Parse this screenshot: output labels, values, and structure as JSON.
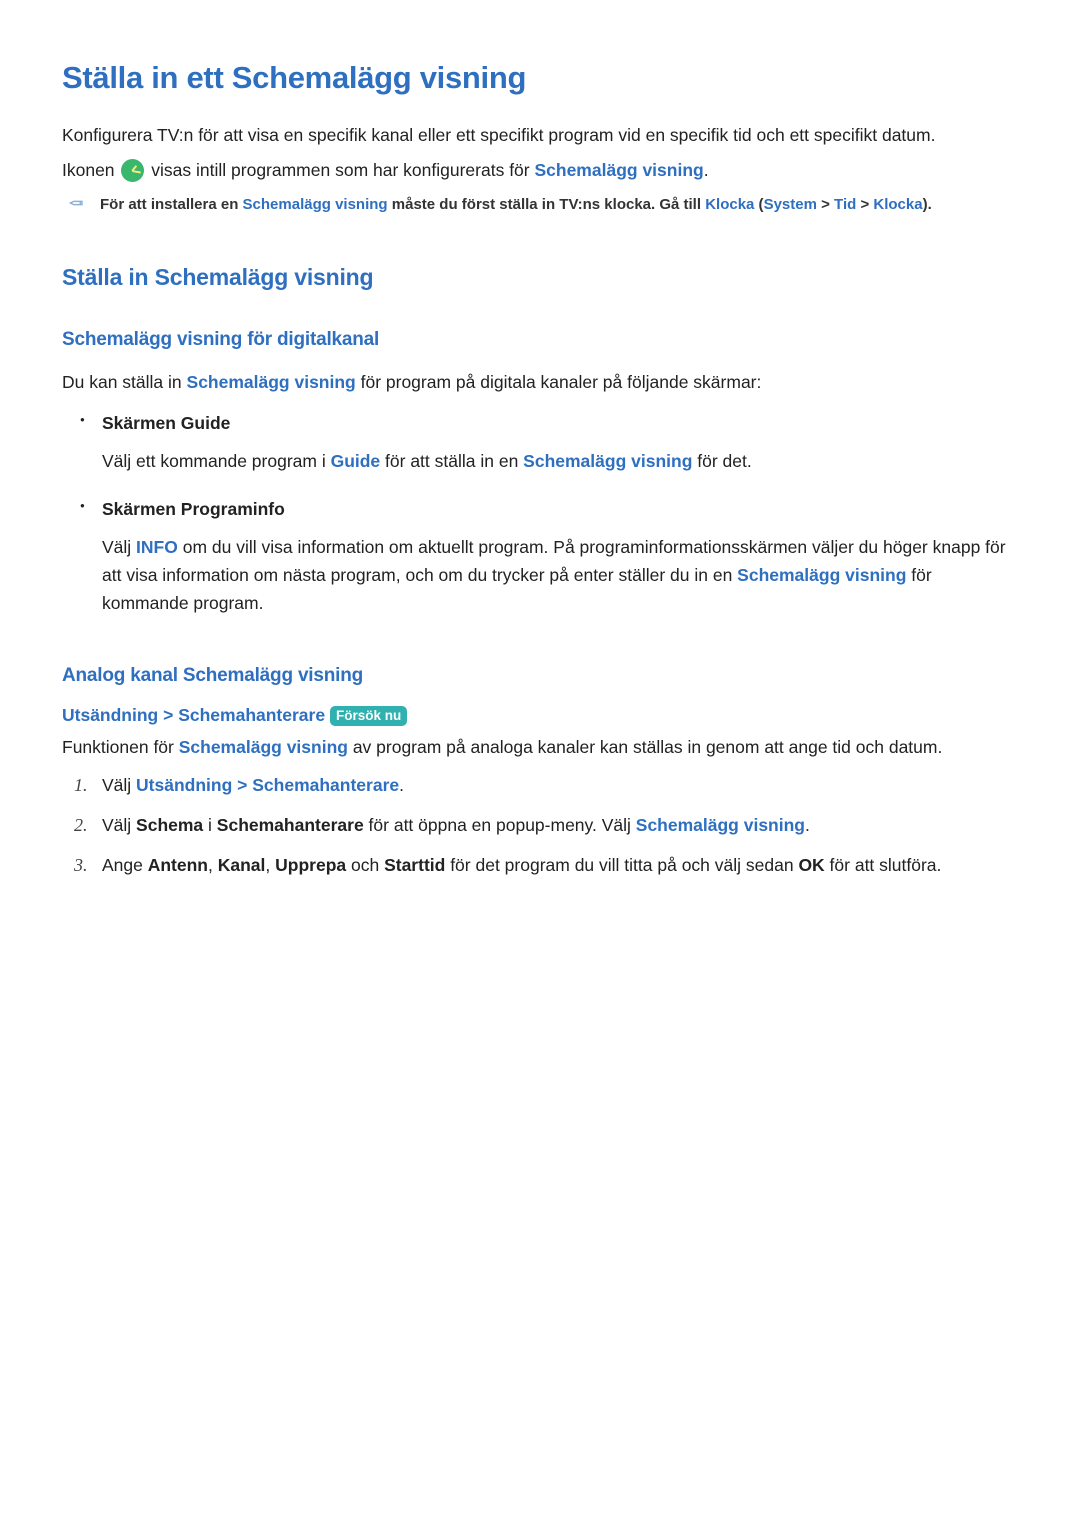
{
  "title": "Ställa in ett Schemalägg visning",
  "intro": {
    "line1": "Konfigurera TV:n för att visa en specifik kanal eller ett specifikt program vid en specifik tid och ett specifikt datum.",
    "line2_a": "Ikonen ",
    "line2_b": " visas intill programmen som har konfigurerats för ",
    "line2_link": "Schemalägg visning",
    "line2_c": "."
  },
  "note": {
    "pre": "För att installera en ",
    "link1": "Schemalägg visning",
    "mid": " måste du först ställa in TV:ns klocka. Gå till ",
    "klocka": "Klocka",
    "open": " (",
    "system": "System",
    "gt1": " > ",
    "tid": "Tid",
    "gt2": " > ",
    "klocka2": "Klocka",
    "close": ")."
  },
  "section2": "Ställa in Schemalägg visning",
  "digital": {
    "heading": "Schemalägg visning för digitalkanal",
    "intro_a": "Du kan ställa in ",
    "intro_link": "Schemalägg visning",
    "intro_b": " för program på digitala kanaler på följande skärmar:",
    "item1_head": "Skärmen Guide",
    "item1_a": "Välj ett kommande program i ",
    "item1_guide": "Guide",
    "item1_b": " för att ställa in en ",
    "item1_link": "Schemalägg visning",
    "item1_c": " för det.",
    "item2_head": "Skärmen Programinfo",
    "item2_a": "Välj ",
    "item2_info": "INFO",
    "item2_b": " om du vill visa information om aktuellt program. På programinformationsskärmen väljer du höger knapp för att visa information om nästa program, och om du trycker på enter ställer du in en ",
    "item2_link": "Schemalägg visning",
    "item2_c": " för kommande program."
  },
  "analog": {
    "heading": "Analog kanal Schemalägg visning",
    "path_a": "Utsändning",
    "gt": " > ",
    "path_b": "Schemahanterare",
    "badge": "Försök nu",
    "intro_a": "Funktionen för ",
    "intro_link": "Schemalägg visning",
    "intro_b": " av program på analoga kanaler kan ställas in genom att ange tid och datum.",
    "step1_a": "Välj ",
    "step1_u": "Utsändning",
    "step1_gt": " > ",
    "step1_s": "Schemahanterare",
    "step1_b": ".",
    "step2_a": "Välj ",
    "step2_sch": "Schema",
    "step2_b": " i ",
    "step2_sh": "Schemahanterare",
    "step2_c": " för att öppna en popup-meny. Välj ",
    "step2_sv": "Schemalägg visning",
    "step2_d": ".",
    "step3_a": "Ange ",
    "step3_ant": "Antenn",
    "step3_c1": ", ",
    "step3_kan": "Kanal",
    "step3_c2": ", ",
    "step3_upp": "Upprepa",
    "step3_c3": " och ",
    "step3_st": "Starttid",
    "step3_b": " för det program du vill titta på och välj sedan ",
    "step3_ok": "OK",
    "step3_end": " för att slutföra."
  }
}
